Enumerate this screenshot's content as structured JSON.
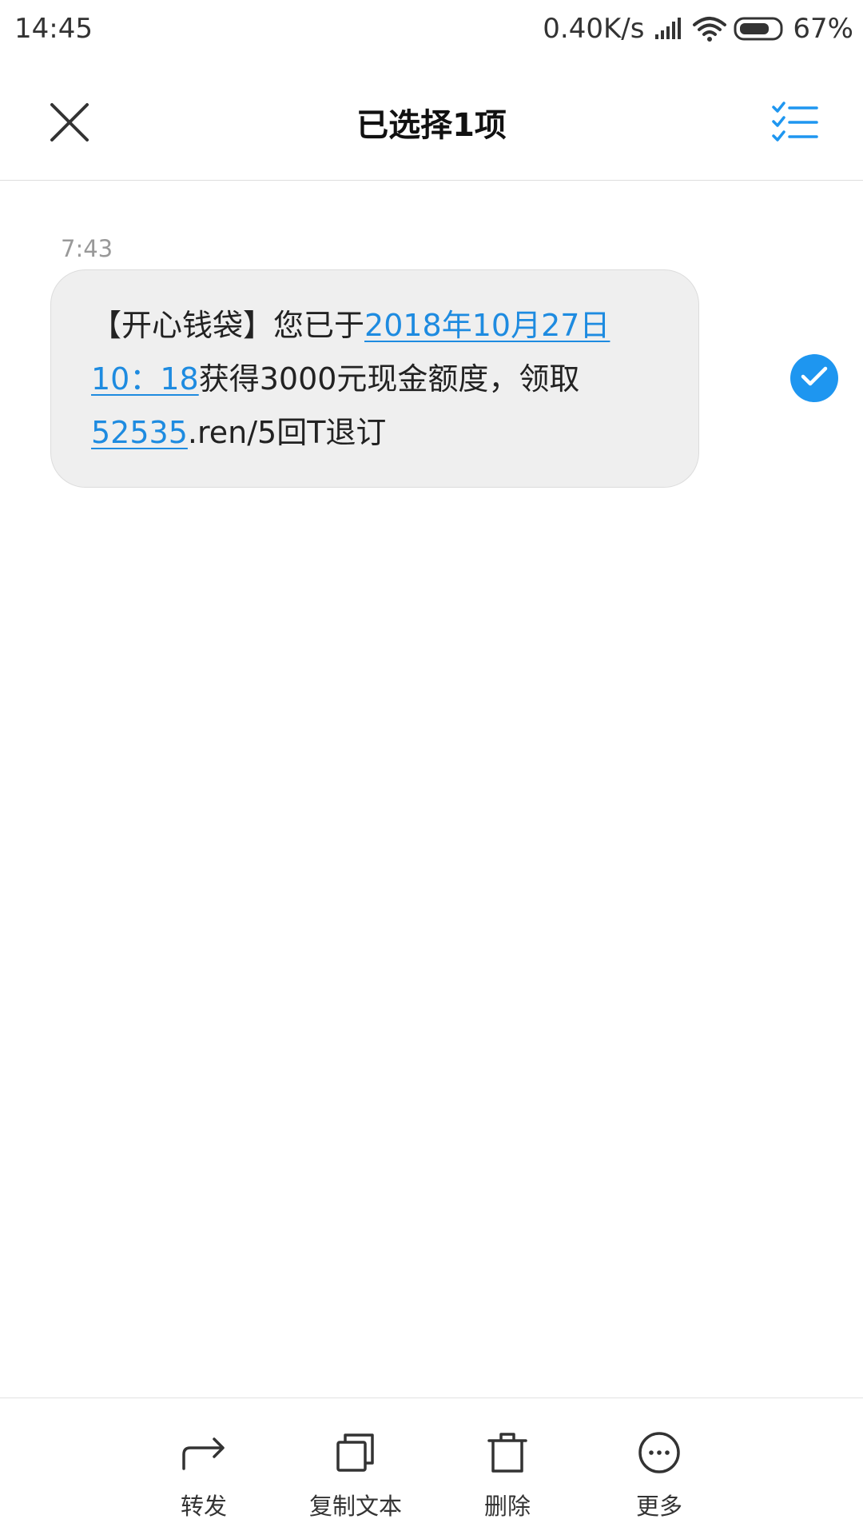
{
  "status_bar": {
    "time": "14:45",
    "network_speed": "0.40K/s",
    "battery": "67%",
    "icons": [
      "signal-icon",
      "wifi-icon",
      "battery-icon"
    ]
  },
  "toolbar": {
    "title": "已选择1项",
    "close_icon": "close-icon",
    "select_all_icon": "select-all-icon"
  },
  "message": {
    "time": "7:43",
    "segments": [
      {
        "text": "【开心钱袋】您已于",
        "link": false
      },
      {
        "text": "2018年10月27日 10：18",
        "link": true
      },
      {
        "text": "获得3000元现金额度，领取 ",
        "link": false
      },
      {
        "text": "52535",
        "link": true
      },
      {
        "text": ".ren/5回T退订",
        "link": false
      }
    ],
    "selected": true
  },
  "actions": [
    {
      "label": "转发",
      "icon": "forward-icon"
    },
    {
      "label": "复制文本",
      "icon": "copy-icon"
    },
    {
      "label": "删除",
      "icon": "trash-icon"
    },
    {
      "label": "更多",
      "icon": "more-icon"
    }
  ],
  "colors": {
    "accent": "#1e96f0",
    "link": "#1e8be0",
    "bubble_bg": "#efefef"
  }
}
